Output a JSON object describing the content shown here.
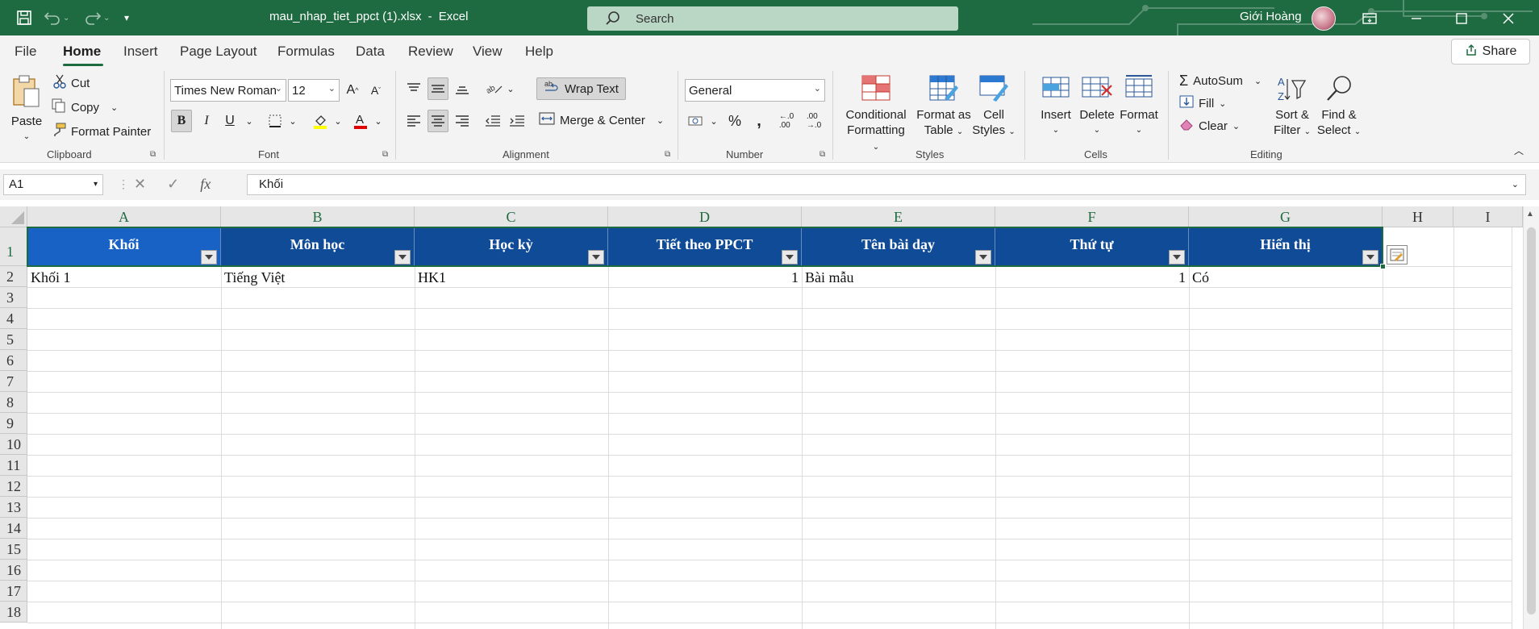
{
  "window": {
    "file_name": "mau_nhap_tiet_ppct (1).xlsx",
    "separator": "-",
    "app_name": "Excel",
    "search_placeholder": "Search",
    "user_name": "Giới Hoàng"
  },
  "menu": {
    "tabs": [
      "File",
      "Home",
      "Insert",
      "Page Layout",
      "Formulas",
      "Data",
      "Review",
      "View",
      "Help"
    ],
    "active_tab": "Home",
    "share_label": "Share"
  },
  "ribbon": {
    "clipboard": {
      "label": "Clipboard",
      "paste": "Paste",
      "cut": "Cut",
      "copy": "Copy",
      "format_painter": "Format Painter"
    },
    "font": {
      "label": "Font",
      "font_name": "Times New Roman",
      "font_size": "12",
      "bold": "B",
      "italic": "I",
      "underline": "U"
    },
    "alignment": {
      "label": "Alignment",
      "wrap_text": "Wrap Text",
      "merge_center": "Merge & Center"
    },
    "number": {
      "label": "Number",
      "format": "General"
    },
    "styles": {
      "label": "Styles",
      "conditional_1": "Conditional",
      "conditional_2": "Formatting",
      "format_table_1": "Format as",
      "format_table_2": "Table",
      "cell_styles_1": "Cell",
      "cell_styles_2": "Styles"
    },
    "cells": {
      "label": "Cells",
      "insert": "Insert",
      "delete": "Delete",
      "format": "Format"
    },
    "editing": {
      "label": "Editing",
      "autosum": "AutoSum",
      "fill": "Fill",
      "clear": "Clear",
      "sort_1": "Sort &",
      "sort_2": "Filter",
      "find_1": "Find &",
      "find_2": "Select"
    }
  },
  "formula_bar": {
    "name_box": "A1",
    "formula": "Khối"
  },
  "sheet": {
    "columns": [
      "A",
      "B",
      "C",
      "D",
      "E",
      "F",
      "G",
      "H",
      "I"
    ],
    "rows": [
      "1",
      "2",
      "3",
      "4",
      "5",
      "6",
      "7",
      "8",
      "9",
      "10",
      "11",
      "12",
      "13",
      "14",
      "15",
      "16",
      "17",
      "18"
    ],
    "headers": [
      "Khối",
      "Môn học",
      "Học kỳ",
      "Tiết theo PPCT",
      "Tên bài dạy",
      "Thứ tự",
      "Hiển thị"
    ],
    "row2": [
      "Khối 1",
      "Tiếng Việt",
      "HK1",
      "1",
      "Bài mẫu",
      "1",
      "Có"
    ]
  },
  "colors": {
    "title_bar": "#1e6b41",
    "header_fill": "#0f4b96",
    "header_first_fill": "#1762c4",
    "selection": "#1e6b41"
  }
}
